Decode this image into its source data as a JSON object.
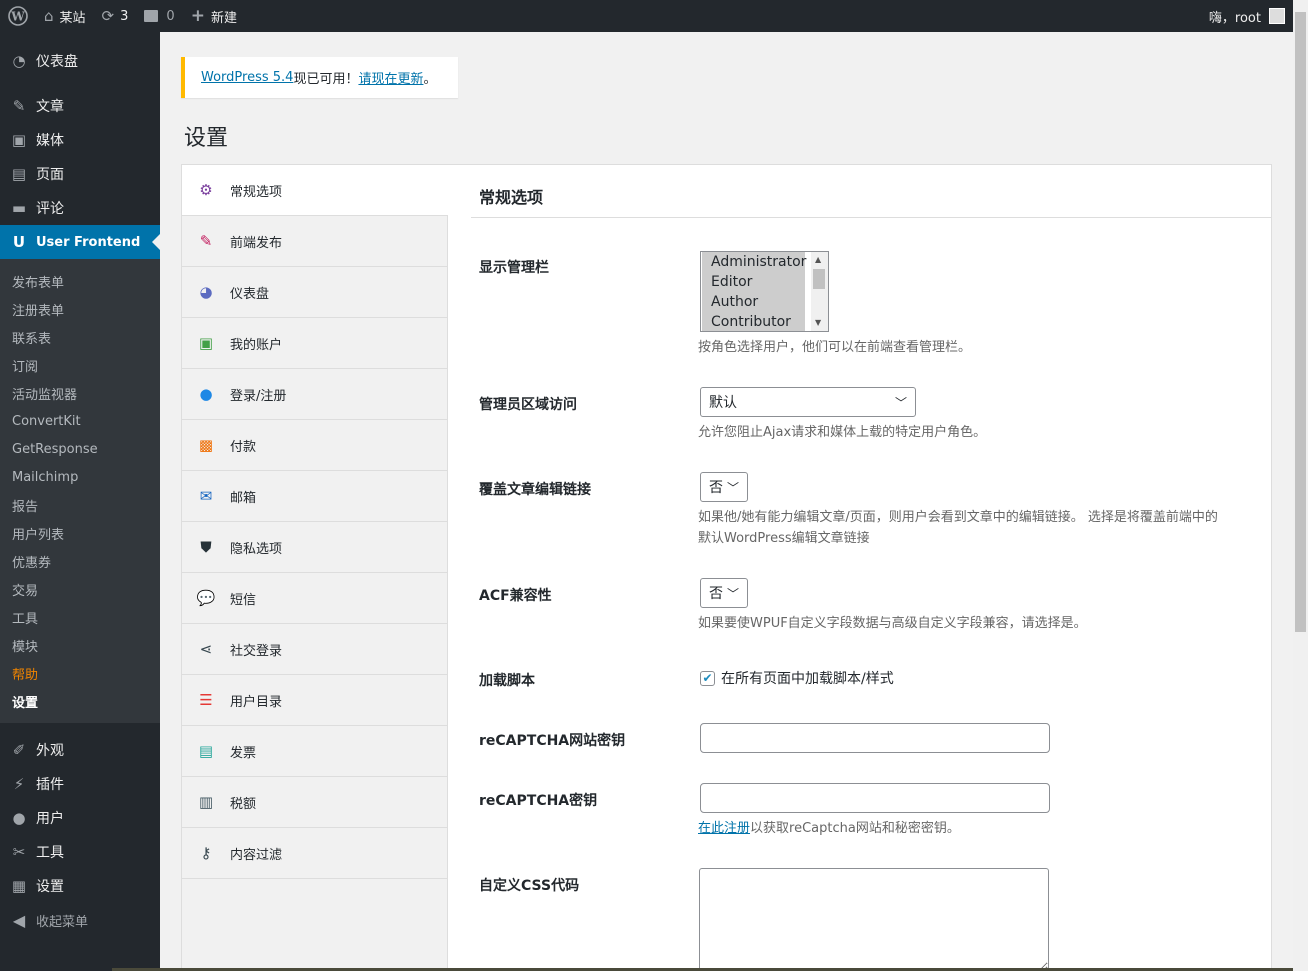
{
  "adminbar": {
    "wp_logo": "wordpress-icon",
    "site_name": "某站",
    "updates_count": "3",
    "comments_count": "0",
    "new_label": "新建",
    "greeting": "嗨，root"
  },
  "sidebar": {
    "top_items": [
      {
        "label": "仪表盘",
        "icon": "dashboard-icon"
      },
      {
        "label": "文章",
        "icon": "pin-icon"
      },
      {
        "label": "媒体",
        "icon": "media-icon"
      },
      {
        "label": "页面",
        "icon": "page-icon"
      },
      {
        "label": "评论",
        "icon": "comment-icon"
      }
    ],
    "current": {
      "label": "User Frontend",
      "icon": "user-frontend-icon"
    },
    "submenu": [
      "发布表单",
      "注册表单",
      "联系表",
      "订阅",
      "活动监视器",
      "ConvertKit",
      "GetResponse",
      "Mailchimp",
      "报告",
      "用户列表",
      "优惠券",
      "交易",
      "工具",
      "模块",
      "帮助",
      "设置"
    ],
    "bottom_items": [
      {
        "label": "外观",
        "icon": "brush-icon"
      },
      {
        "label": "插件",
        "icon": "plugin-icon"
      },
      {
        "label": "用户",
        "icon": "user-icon"
      },
      {
        "label": "工具",
        "icon": "wrench-icon"
      },
      {
        "label": "设置",
        "icon": "settings-icon"
      }
    ],
    "collapse_label": "收起菜单"
  },
  "notice": {
    "link1": "WordPress 5.4",
    "text": "现已可用！",
    "link2": "请现在更新",
    "end": "。"
  },
  "page_title": "设置",
  "tabs": [
    {
      "label": "常规选项",
      "icon": "gear-icon",
      "color": "#7a3e9d"
    },
    {
      "label": "前端发布",
      "icon": "edit-icon",
      "color": "#c2185b"
    },
    {
      "label": "仪表盘",
      "icon": "dashboard-icon",
      "color": "#5c6bc0"
    },
    {
      "label": "我的账户",
      "icon": "id-card-icon",
      "color": "#43a047"
    },
    {
      "label": "登录/注册",
      "icon": "user-icon",
      "color": "#1e88e5"
    },
    {
      "label": "付款",
      "icon": "payment-icon",
      "color": "#ef6c00"
    },
    {
      "label": "邮箱",
      "icon": "mail-icon",
      "color": "#1565c0"
    },
    {
      "label": "隐私选项",
      "icon": "shield-icon",
      "color": "#263238"
    },
    {
      "label": "短信",
      "icon": "chat-icon",
      "color": "#1e88e5"
    },
    {
      "label": "社交登录",
      "icon": "share-icon",
      "color": "#37474f"
    },
    {
      "label": "用户目录",
      "icon": "list-icon",
      "color": "#e53935"
    },
    {
      "label": "发票",
      "icon": "invoice-icon",
      "color": "#26a69a"
    },
    {
      "label": "税额",
      "icon": "tax-icon",
      "color": "#455a64"
    },
    {
      "label": "内容过滤",
      "icon": "key-icon",
      "color": "#37474f"
    }
  ],
  "section": {
    "title": "常规选项",
    "show_admin_bar": {
      "label": "显示管理栏",
      "options": [
        "Administrator",
        "Editor",
        "Author",
        "Contributor"
      ],
      "desc": "按角色选择用户，他们可以在前端查看管理栏。"
    },
    "admin_access": {
      "label": "管理员区域访问",
      "value": "默认",
      "desc": "允许您阻止Ajax请求和媒体上载的特定用户角色。"
    },
    "override_edit": {
      "label": "覆盖文章编辑链接",
      "value": "否",
      "desc1": "如果他/她有能力编辑文章/页面，则用户会看到文章中的编辑链接。 选择是将覆盖前端中的",
      "desc2": "默认WordPress编辑文章链接"
    },
    "acf": {
      "label": "ACF兼容性",
      "value": "否",
      "desc": "如果要使WPUF自定义字段数据与高级自定义字段兼容，请选择是。"
    },
    "load_script": {
      "label": "加载脚本",
      "checkbox_label": "在所有页面中加载脚本/样式"
    },
    "recaptcha_site": {
      "label": "reCAPTCHA网站密钥",
      "value": ""
    },
    "recaptcha_secret": {
      "label": "reCAPTCHA密钥",
      "value": "",
      "link": "在此注册",
      "desc": "以获取reCaptcha网站和秘密密钥。"
    },
    "custom_css": {
      "label": "自定义CSS代码",
      "value": ""
    }
  }
}
